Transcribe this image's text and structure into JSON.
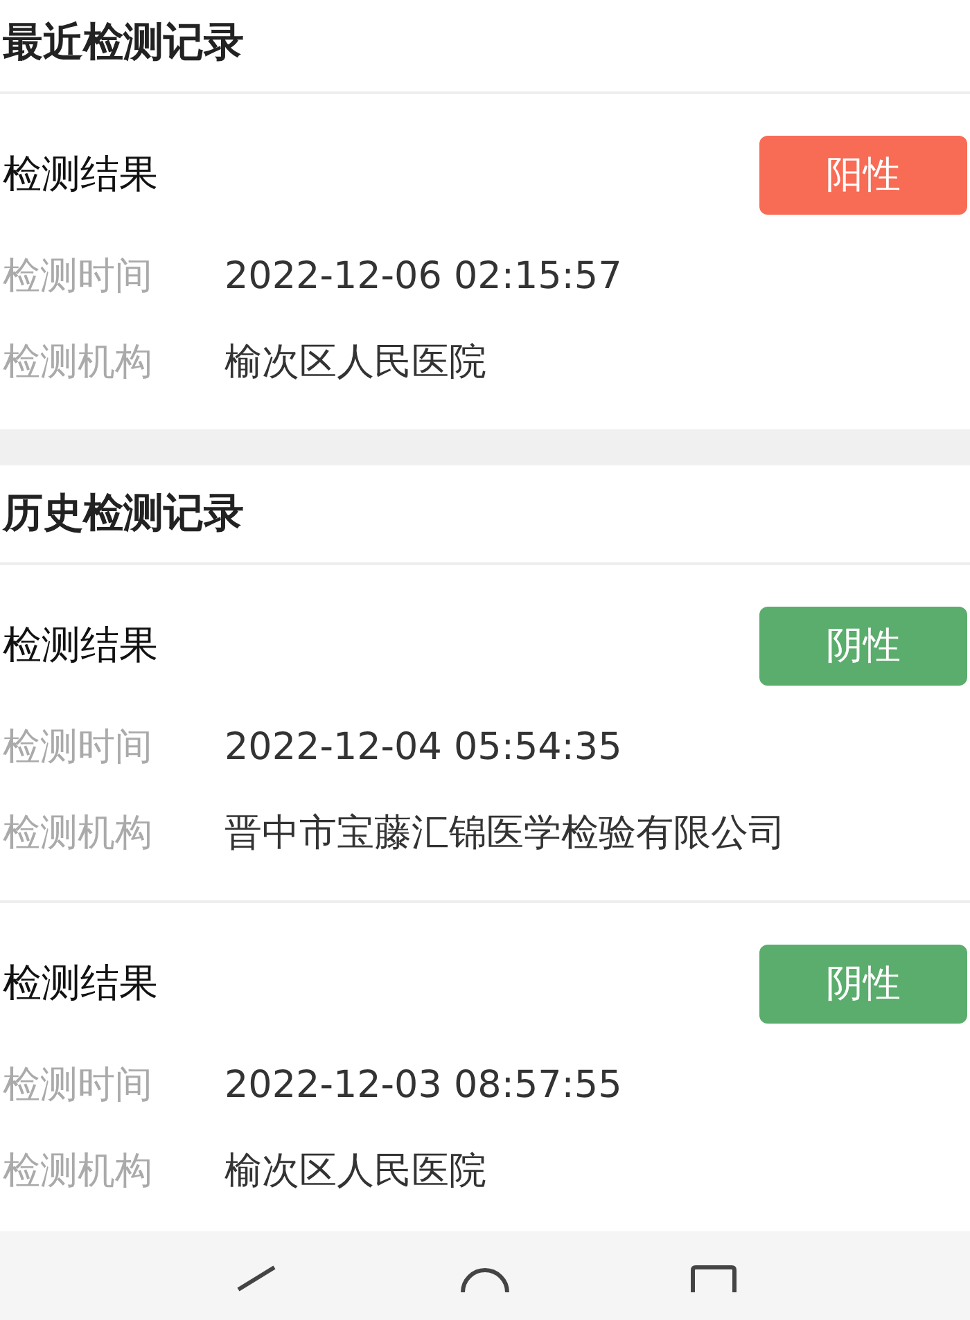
{
  "sections": [
    {
      "title": "最近检测记录",
      "records": [
        {
          "result_label": "检测结果",
          "result": "阳性",
          "color": "#f86b55",
          "fields": [
            {
              "label": "检测时间",
              "value": "2022-12-06 02:15:57"
            },
            {
              "label": "检测机构",
              "value": "榆次区人民医院"
            }
          ]
        }
      ]
    },
    {
      "title": "历史检测记录",
      "records": [
        {
          "result_label": "检测结果",
          "result": "阴性",
          "color": "#5aad6c",
          "fields": [
            {
              "label": "检测时间",
              "value": "2022-12-04 05:54:35"
            },
            {
              "label": "检测机构",
              "value": "晋中市宝藤汇锦医学检验有限公司"
            }
          ]
        },
        {
          "result_label": "检测结果",
          "result": "阴性",
          "color": "#5aad6c",
          "fields": [
            {
              "label": "检测时间",
              "value": "2022-12-03 08:57:55"
            },
            {
              "label": "检测机构",
              "value": "榆次区人民医院"
            }
          ]
        }
      ]
    }
  ]
}
